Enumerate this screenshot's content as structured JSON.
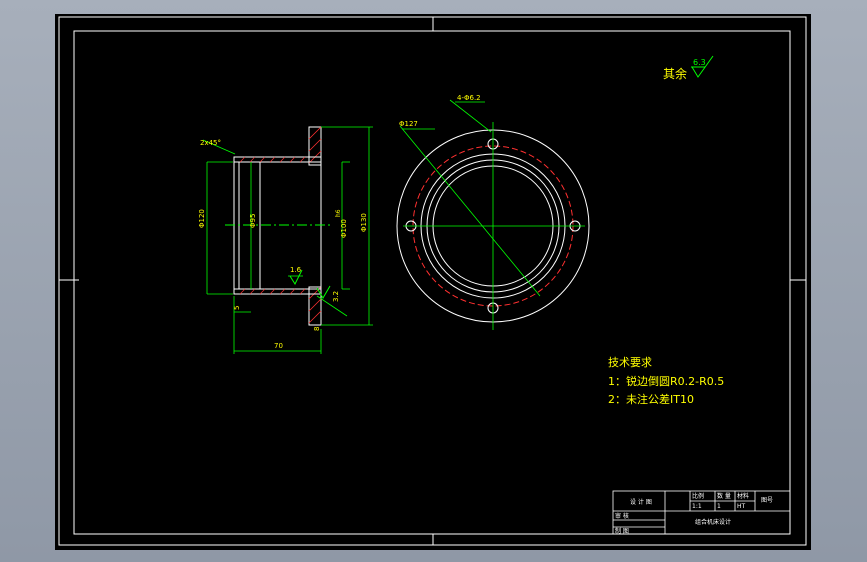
{
  "drawing": {
    "roughness_label": "其余",
    "roughness_value": "6.3",
    "chamfer_note": "2x45°",
    "dims": {
      "d_outer_flange": "Φ120",
      "d_bore": "Φ95",
      "d_shaft": "Φ100",
      "d_flange": "Φ130",
      "d_bolt_circle": "Φ127",
      "holes": "4-Φ6.2",
      "length": "70",
      "flange_thk": "8",
      "wall": "5",
      "ra_inner": "1.6",
      "ra_face": "3.2",
      "fit": "h6"
    }
  },
  "tech_req": {
    "title": "技术要求",
    "items": [
      "1：锐边倒圆R0.2-R0.5",
      "2：未注公差IT10"
    ]
  },
  "title_block": {
    "c1": "设 计 图",
    "c2": "比例",
    "c3": "数 量",
    "c4": "材料",
    "c5": "1:1",
    "c6": "1",
    "c7": "HT",
    "c8": "审 核",
    "c9": "制 图",
    "c10": "图号",
    "c11": "组合机床设计"
  }
}
